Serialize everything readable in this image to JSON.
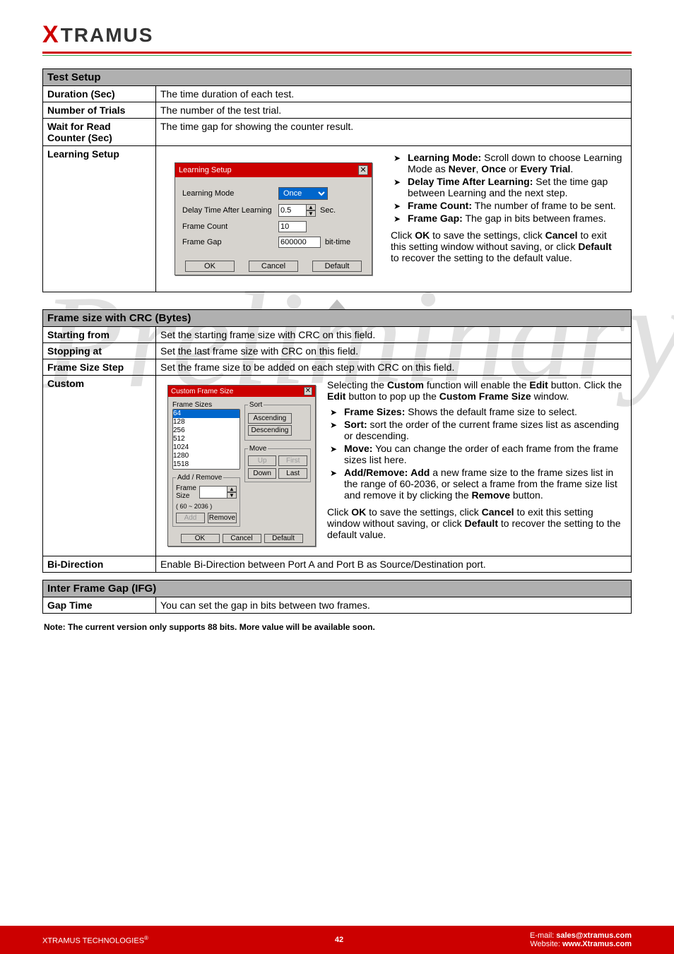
{
  "brand": {
    "x": "X",
    "rest": "TRAMUS"
  },
  "watermark": "Preliminary",
  "table1": {
    "header": "Test Setup",
    "rows": {
      "duration": {
        "label": "Duration (Sec)",
        "desc": "The time duration of each test."
      },
      "trials": {
        "label": "Number of Trials",
        "desc": "The number of the test trial."
      },
      "waitread": {
        "label": "Wait for Read Counter (Sec)",
        "desc": "The time gap for showing the counter result."
      },
      "learning": {
        "label": "Learning Setup",
        "dialog": {
          "title": "Learning Setup",
          "mode_label": "Learning Mode",
          "mode_value": "Once",
          "delay_label": "Delay Time After Learning",
          "delay_value": "0.5",
          "delay_unit": "Sec.",
          "framecount_label": "Frame Count",
          "framecount_value": "10",
          "framegap_label": "Frame Gap",
          "framegap_value": "600000",
          "framegap_unit": "bit-time",
          "ok": "OK",
          "cancel": "Cancel",
          "default": "Default"
        },
        "bul": {
          "mode_title": "Learning Mode:",
          "mode_text": " Scroll down to choose Learning Mode as ",
          "mode_never": "Never",
          "mode_once": "Once",
          "mode_or": " or ",
          "mode_every": "Every Trial",
          "delay_title": "Delay Time After Learning:",
          "delay_text": " Set the time gap between Learning and the next step.",
          "count_title": "Frame Count:",
          "count_text": " The number of frame to be sent.",
          "gap_title": "Frame Gap:",
          "gap_text": " The gap in bits between frames."
        },
        "footer_a": "Click ",
        "footer_ok": "OK",
        "footer_b": " to save the settings, click ",
        "footer_cancel": "Cancel",
        "footer_c": " to exit this setting window without saving, or click ",
        "footer_default": "Default",
        "footer_d": " to recover the setting to the default value."
      }
    }
  },
  "table2": {
    "header": "Frame size with CRC (Bytes)",
    "rows": {
      "start": {
        "label": "Starting from",
        "desc": "Set the starting frame size with CRC on this field."
      },
      "stop": {
        "label": "Stopping at",
        "desc": "Set the last frame size with CRC on this field."
      },
      "step": {
        "label": "Frame Size Step",
        "desc": "Set the frame size to be added on each step with CRC on this field."
      },
      "custom": {
        "label": "Custom",
        "intro_a": "Selecting the ",
        "intro_custom": "Custom",
        "intro_b": " function will enable the ",
        "intro_edit": "Edit",
        "intro_c": " button. Click the ",
        "intro_edit2": "Edit",
        "intro_d": " button to pop up the ",
        "intro_win": "Custom Frame Size",
        "intro_e": " window.",
        "dialog": {
          "title": "Custom Frame Size",
          "sizes_label": "Frame Sizes",
          "sizes": [
            "64",
            "128",
            "256",
            "512",
            "1024",
            "1280",
            "1518"
          ],
          "sort_legend": "Sort",
          "asc": "Ascending",
          "desc": "Descending",
          "move_legend": "Move",
          "up": "Up",
          "first": "First",
          "down": "Down",
          "last": "Last",
          "addrm_legend": "Add / Remove",
          "addrm_lbl": "Frame Size",
          "addrm_range": "( 60 ~ 2036 )",
          "add": "Add",
          "remove": "Remove",
          "ok": "OK",
          "cancel": "Cancel",
          "default": "Default"
        },
        "bul": {
          "fs_title": "Frame Sizes:",
          "fs_text": " Shows the default frame size to select.",
          "sort_title": "Sort:",
          "sort_text": " sort the order of the current frame sizes list as ascending or descending.",
          "move_title": "Move:",
          "move_text": " You can change the order of each frame from the frame sizes list here.",
          "ar_title": "Add/Remove:",
          "ar_text_a": " ",
          "ar_add": "Add",
          "ar_text_b": " a new frame size to the frame sizes list in the range of 60-2036, or select a frame from the frame size list and remove it by clicking the ",
          "ar_remove": "Remove",
          "ar_text_c": " button."
        },
        "footer_a": "Click ",
        "footer_ok": "OK",
        "footer_b": " to save the settings, click ",
        "footer_cancel": "Cancel",
        "footer_c": " to exit this setting window without saving, or click ",
        "footer_default": "Default",
        "footer_d": " to recover the setting to the default value."
      },
      "bidir": {
        "label": "Bi-Direction",
        "desc": "Enable Bi-Direction between Port A and Port B as Source/Destination port."
      }
    }
  },
  "table3": {
    "header": "Inter Frame Gap (IFG)",
    "gap": {
      "label": "Gap Time",
      "desc": "You can set the gap in bits between two frames."
    }
  },
  "note": "Note: The current version only supports 88 bits. More value will be available soon.",
  "footer": {
    "left_a": "XTRAMUS TECHNOLOGIES",
    "page": "42",
    "email_l": "E-mail: ",
    "email_v": "sales@xtramus.com",
    "web_l": "Website:  ",
    "web_v": "www.Xtramus.com"
  }
}
